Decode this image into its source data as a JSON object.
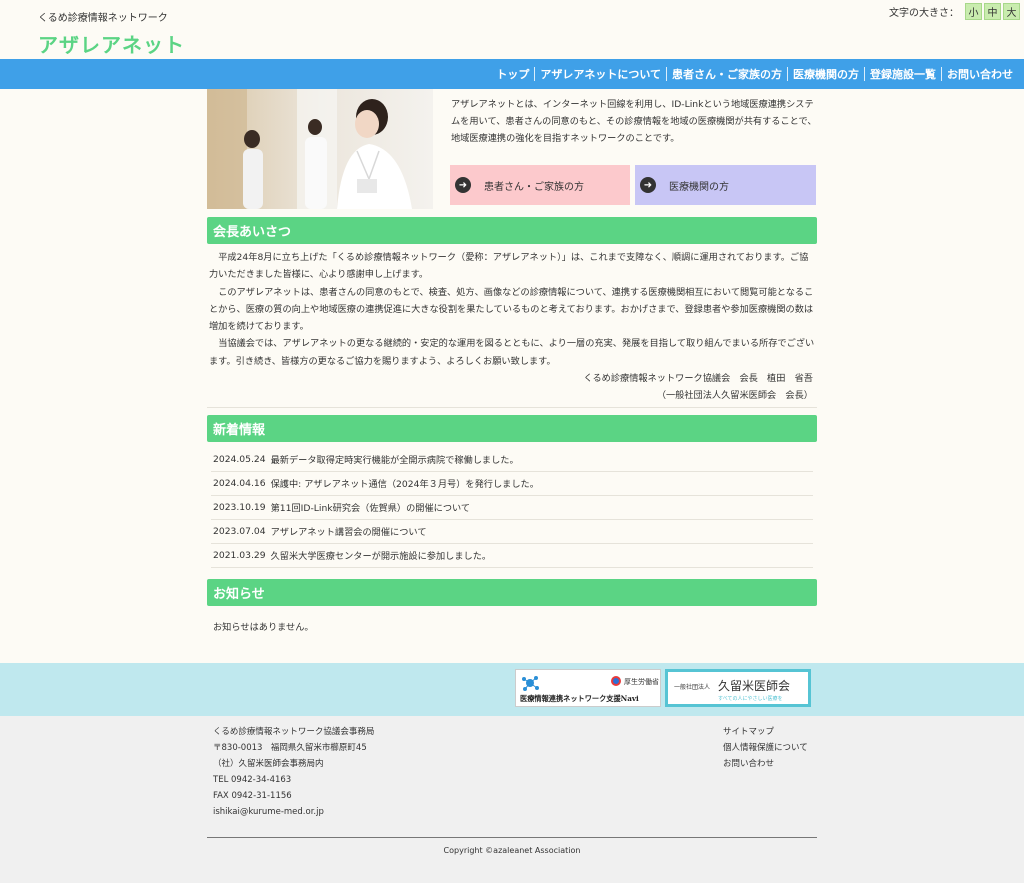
{
  "header": {
    "subtitle": "くるめ診療情報ネットワーク",
    "title": "アザレアネット",
    "font_size_label": "文字の大きさ：",
    "font_sizes": [
      "小",
      "中",
      "大"
    ]
  },
  "nav": {
    "items": [
      "トップ",
      "アザレアネットについて",
      "患者さん・ご家族の方",
      "医療機関の方",
      "登録施設一覧",
      "お問い合わせ"
    ]
  },
  "intro": {
    "text": "アザレアネットとは、インターネット回線を利用し、ID-Linkという地域医療連携システムを用いて、患者さんの同意のもと、その診療情報を地域の医療機関が共有することで、地域医療連携の強化を目指すネットワークのことです。",
    "cta_patient": "患者さん・ご家族の方",
    "cta_medical": "医療機関の方"
  },
  "greeting": {
    "heading": "会長あいさつ",
    "paragraphs": [
      "平成24年8月に立ち上げた「くるめ診療情報ネットワーク（愛称：アザレアネット）」は、これまで支障なく、順調に運用されております。ご協力いただきました皆様に、心より感謝申し上げます。",
      "このアザレアネットは、患者さんの同意のもとで、検査、処方、画像などの診療情報について、連携する医療機関相互において閲覧可能となることから、医療の質の向上や地域医療の連携促進に大きな役割を果たしているものと考えております。おかげさまで、登録患者や参加医療機関の数は増加を続けております。",
      "当協議会では、アザレアネットの更なる継続的・安定的な運用を図るとともに、より一層の充実、発展を目指して取り組んでまいる所存でございます。引き続き、皆様方の更なるご協力を賜りますよう、よろしくお願い致します。"
    ],
    "sign1": "くるめ診療情報ネットワーク協議会　会長　植田　省吾",
    "sign2": "（一般社団法人久留米医師会　会長）"
  },
  "news": {
    "heading": "新着情報",
    "items": [
      {
        "date": "2024.05.24",
        "text": "最新データ取得定時実行機能が全開示病院で稼働しました。"
      },
      {
        "date": "2024.04.16",
        "text": "保護中: アザレアネット通信（2024年３月号）を発行しました。"
      },
      {
        "date": "2023.10.19",
        "text": "第11回ID-Link研究会（佐賀県）の開催について"
      },
      {
        "date": "2023.07.04",
        "text": "アザレアネット講習会の開催について"
      },
      {
        "date": "2021.03.29",
        "text": "久留米大学医療センターが開示施設に参加しました。"
      }
    ]
  },
  "notice": {
    "heading": "お知らせ",
    "text": "お知らせはありません。"
  },
  "banners": {
    "mhlw_label": "厚生労働省",
    "navi_label": "医療情報連携ネットワーク支援Navi",
    "ishikai_prefix": "一般社団法人",
    "ishikai_name": "久留米医師会",
    "ishikai_tagline": "すべての人にやさしい医療を"
  },
  "footer": {
    "lines": [
      "くるめ診療情報ネットワーク協議会事務局",
      "〒830-0013　福岡県久留米市櫛原町45",
      "（社）久留米医師会事務局内",
      "TEL 0942-34-4163",
      "FAX 0942-31-1156",
      "ishikai@kurume-med.or.jp"
    ],
    "links": [
      "サイトマップ",
      "個人情報保護について",
      "お問い合わせ"
    ],
    "copyright": "Copyright ©azaleanet Association"
  },
  "colors": {
    "accent_green": "#5bd484",
    "nav_blue": "#3fa0e8",
    "cta_pink": "#fcc9cc",
    "cta_lavender": "#c8c6f5",
    "banner_band": "#bfe8ee"
  }
}
